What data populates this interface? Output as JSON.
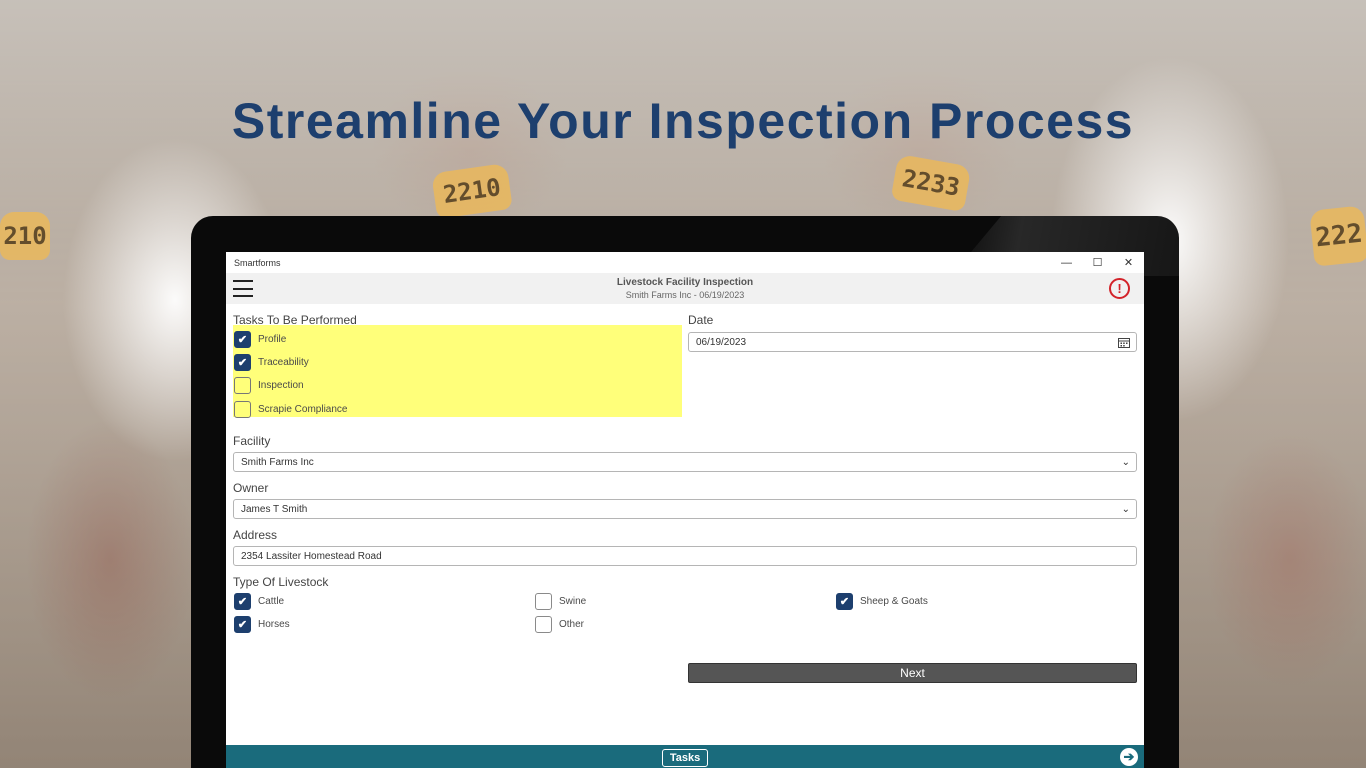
{
  "headline": "Streamline Your Inspection Process",
  "background": {
    "tags": [
      "2210",
      "2233",
      "210",
      "222"
    ]
  },
  "window": {
    "app_name": "Smartforms",
    "controls": {
      "minimize": "—",
      "maximize": "☐",
      "close": "✕"
    }
  },
  "header": {
    "title": "Livestock Facility Inspection",
    "subtitle": "Smith Farms Inc - 06/19/2023",
    "alert_glyph": "!"
  },
  "tasks": {
    "label": "Tasks To Be Performed",
    "items": [
      {
        "label": "Profile",
        "checked": true
      },
      {
        "label": "Traceability",
        "checked": true
      },
      {
        "label": "Inspection",
        "checked": false
      },
      {
        "label": "Scrapie Compliance",
        "checked": false
      }
    ]
  },
  "date": {
    "label": "Date",
    "value": "06/19/2023",
    "icon": "calendar-icon"
  },
  "facility": {
    "label": "Facility",
    "value": "Smith Farms Inc"
  },
  "owner": {
    "label": "Owner",
    "value": "James T Smith"
  },
  "address": {
    "label": "Address",
    "value": "2354 Lassiter Homestead Road"
  },
  "livestock": {
    "label": "Type Of Livestock",
    "items": [
      {
        "label": "Cattle",
        "checked": true
      },
      {
        "label": "Swine",
        "checked": false
      },
      {
        "label": "Sheep & Goats",
        "checked": true
      },
      {
        "label": "Horses",
        "checked": true
      },
      {
        "label": "Other",
        "checked": false
      }
    ]
  },
  "next_label": "Next",
  "footer": {
    "tasks_label": "Tasks",
    "arrow_glyph": "➔"
  },
  "glyphs": {
    "check": "✔",
    "chevron": "⌄"
  },
  "colors": {
    "headline": "#1d3f6e",
    "checkbox_checked": "#1d3f6e",
    "highlight": "#ffff7a",
    "footer": "#1a6b7c",
    "alert": "#d3232a",
    "button": "#555555"
  }
}
